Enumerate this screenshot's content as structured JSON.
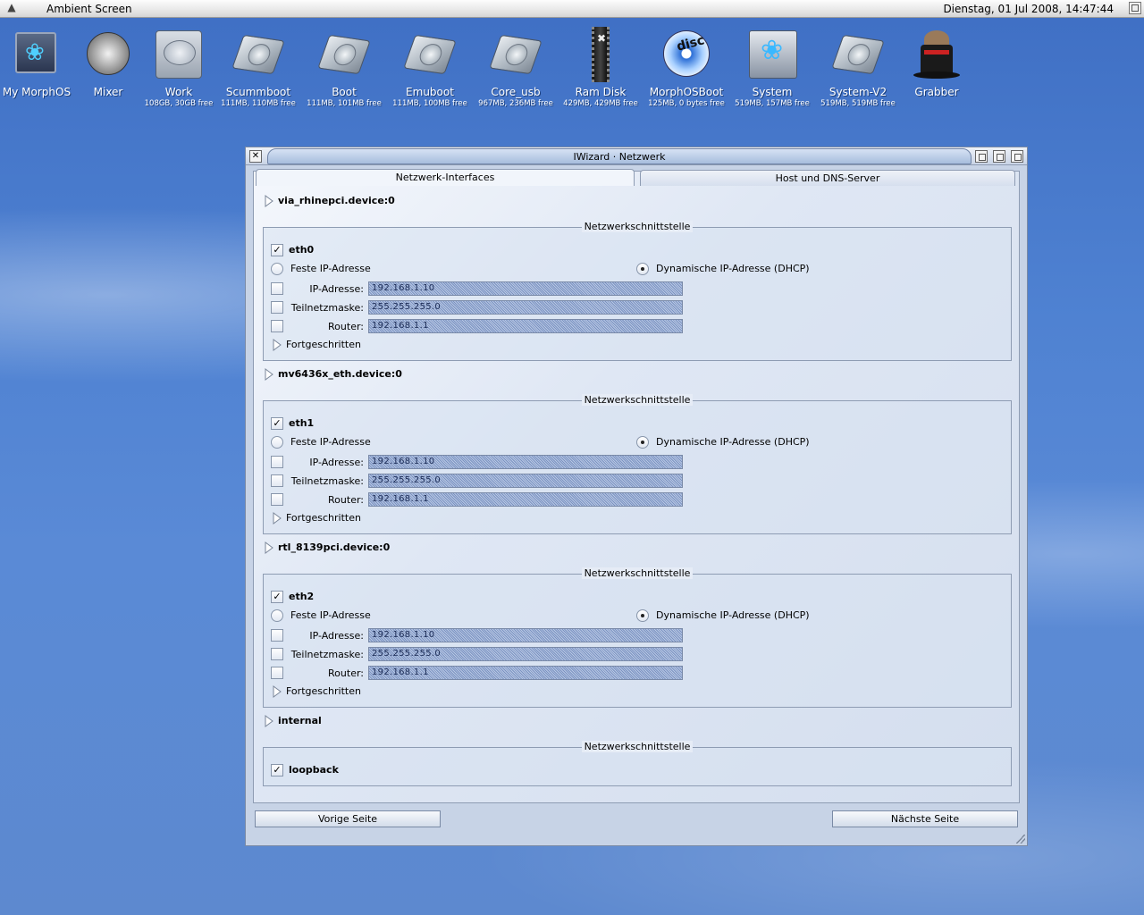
{
  "screen": {
    "title": "Ambient Screen",
    "clock": "Dienstag, 01 Jul 2008, 14:47:44"
  },
  "desktop_icons": [
    {
      "label": "My MorphOS",
      "sub": ""
    },
    {
      "label": "Mixer",
      "sub": ""
    },
    {
      "label": "Work",
      "sub": "108GB, 30GB free"
    },
    {
      "label": "Scummboot",
      "sub": "111MB, 110MB free"
    },
    {
      "label": "Boot",
      "sub": "111MB, 101MB free"
    },
    {
      "label": "Emuboot",
      "sub": "111MB, 100MB free"
    },
    {
      "label": "Core_usb",
      "sub": "967MB, 236MB free"
    },
    {
      "label": "Ram Disk",
      "sub": "429MB, 429MB free"
    },
    {
      "label": "MorphOSBoot",
      "sub": "125MB, 0 bytes free"
    },
    {
      "label": "System",
      "sub": "519MB, 157MB free"
    },
    {
      "label": "System-V2",
      "sub": "519MB, 519MB free"
    },
    {
      "label": "Grabber",
      "sub": ""
    }
  ],
  "window": {
    "title": "IWizard · Netzwerk",
    "tabs": [
      "Netzwerk-Interfaces",
      "Host und DNS-Server"
    ],
    "group_title": "Netzwerkschnittstelle",
    "static_label": "Feste IP-Adresse",
    "dhcp_label": "Dynamische IP-Adresse (DHCP)",
    "ip_label": "IP-Adresse:",
    "mask_label": "Teilnetzmaske:",
    "router_label": "Router:",
    "advanced_label": "Fortgeschritten",
    "checkmark": "✓",
    "devices": [
      {
        "device": "via_rhinepci.device:0",
        "iface": "eth0",
        "ip": "192.168.1.10",
        "mask": "255.255.255.0",
        "router": "192.168.1.1"
      },
      {
        "device": "mv6436x_eth.device:0",
        "iface": "eth1",
        "ip": "192.168.1.10",
        "mask": "255.255.255.0",
        "router": "192.168.1.1"
      },
      {
        "device": "rtl_8139pci.device:0",
        "iface": "eth2",
        "ip": "192.168.1.10",
        "mask": "255.255.255.0",
        "router": "192.168.1.1"
      }
    ],
    "internal": {
      "device": "internal",
      "iface": "loopback"
    },
    "prev_button": "Vorige Seite",
    "next_button": "Nächste Seite"
  }
}
